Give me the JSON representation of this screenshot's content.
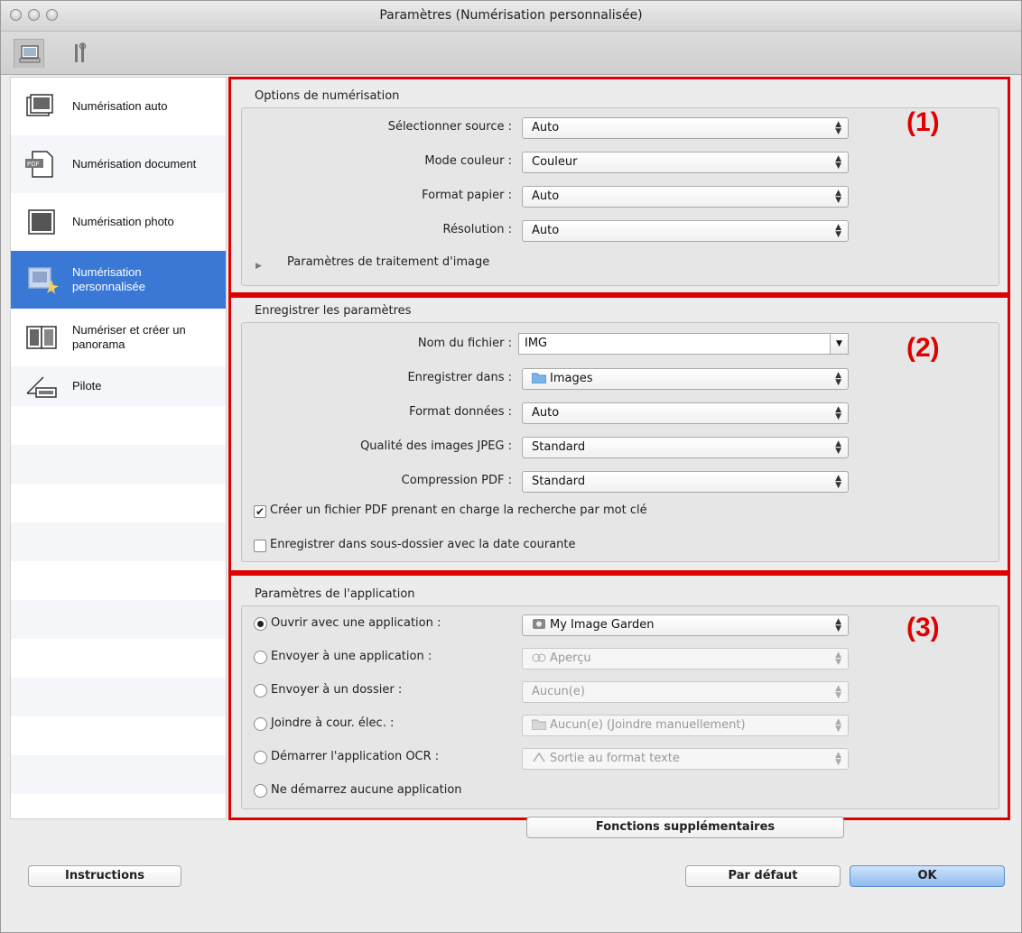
{
  "window": {
    "title": "Paramètres (Numérisation personnalisée)"
  },
  "toolbar": {
    "icons": [
      "scan-tab-icon",
      "tools-tab-icon"
    ]
  },
  "sidebar": {
    "items": [
      {
        "label": "Numérisation auto",
        "icon": "auto-scan-icon"
      },
      {
        "label": "Numérisation document",
        "icon": "pdf-document-icon"
      },
      {
        "label": "Numérisation photo",
        "icon": "photo-scan-icon"
      },
      {
        "label": "Numérisation personnalisée",
        "icon": "custom-scan-icon",
        "active": true
      },
      {
        "label": "Numériser et créer un panorama",
        "icon": "panorama-icon"
      },
      {
        "label": "Pilote",
        "icon": "driver-icon"
      }
    ]
  },
  "scan_options": {
    "title": "Options de numérisation",
    "number": "(1)",
    "source_label": "Sélectionner source :",
    "source_value": "Auto",
    "color_label": "Mode couleur :",
    "color_value": "Couleur",
    "paper_label": "Format papier :",
    "paper_value": "Auto",
    "resolution_label": "Résolution :",
    "resolution_value": "Auto",
    "image_processing_label": "Paramètres de traitement d'image"
  },
  "save_settings": {
    "title": "Enregistrer les paramètres",
    "number": "(2)",
    "filename_label": "Nom du fichier :",
    "filename_value": "IMG",
    "save_in_label": "Enregistrer dans :",
    "save_in_value": "Images",
    "data_format_label": "Format données :",
    "data_format_value": "Auto",
    "jpeg_label": "Qualité des images JPEG :",
    "jpeg_value": "Standard",
    "pdf_label": "Compression PDF :",
    "pdf_value": "Standard",
    "searchable_pdf_label": "Créer un fichier PDF prenant en charge la recherche par mot clé",
    "searchable_pdf_checked": true,
    "subfolder_label": "Enregistrer dans sous-dossier avec la date courante",
    "subfolder_checked": false
  },
  "app_settings": {
    "title": "Paramètres de l'application",
    "number": "(3)",
    "open_label": "Ouvrir avec une application :",
    "open_value": "My Image Garden",
    "send_app_label": "Envoyer à une application :",
    "send_app_value": "Aperçu",
    "send_folder_label": "Envoyer à un dossier :",
    "send_folder_value": "Aucun(e)",
    "email_label": "Joindre à cour. élec. :",
    "email_value": "Aucun(e) (Joindre manuellement)",
    "ocr_label": "Démarrer l'application OCR :",
    "ocr_value": "Sortie au format texte",
    "none_label": "Ne démarrez aucune application",
    "selected": "open",
    "more_button": "Fonctions supplémentaires"
  },
  "footer": {
    "instructions": "Instructions",
    "defaults": "Par défaut",
    "ok": "OK"
  },
  "colors": {
    "highlight": "#e00000",
    "selection": "#3a78d6"
  }
}
